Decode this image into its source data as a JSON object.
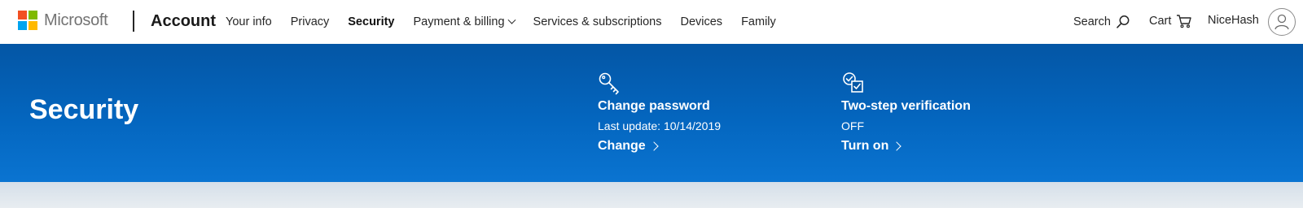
{
  "header": {
    "brand": "Microsoft",
    "brand_colors": [
      "#f25022",
      "#7fba00",
      "#00a4ef",
      "#ffb900"
    ],
    "section_title": "Account",
    "nav": [
      {
        "label": "Your info",
        "active": false
      },
      {
        "label": "Privacy",
        "active": false
      },
      {
        "label": "Security",
        "active": true
      },
      {
        "label": "Payment & billing",
        "active": false,
        "dropdown": true
      },
      {
        "label": "Services & subscriptions",
        "active": false
      },
      {
        "label": "Devices",
        "active": false
      },
      {
        "label": "Family",
        "active": false
      }
    ],
    "search_label": "Search",
    "cart_label": "Cart",
    "user_name": "NiceHash"
  },
  "banner": {
    "title": "Security",
    "bg_color": "#0466bf",
    "cards": [
      {
        "icon": "key-icon",
        "title": "Change password",
        "subtitle": "Last update: 10/14/2019",
        "link": "Change"
      },
      {
        "icon": "checkbox-verification-icon",
        "title": "Two-step verification",
        "subtitle": "OFF",
        "link": "Turn on"
      }
    ]
  }
}
